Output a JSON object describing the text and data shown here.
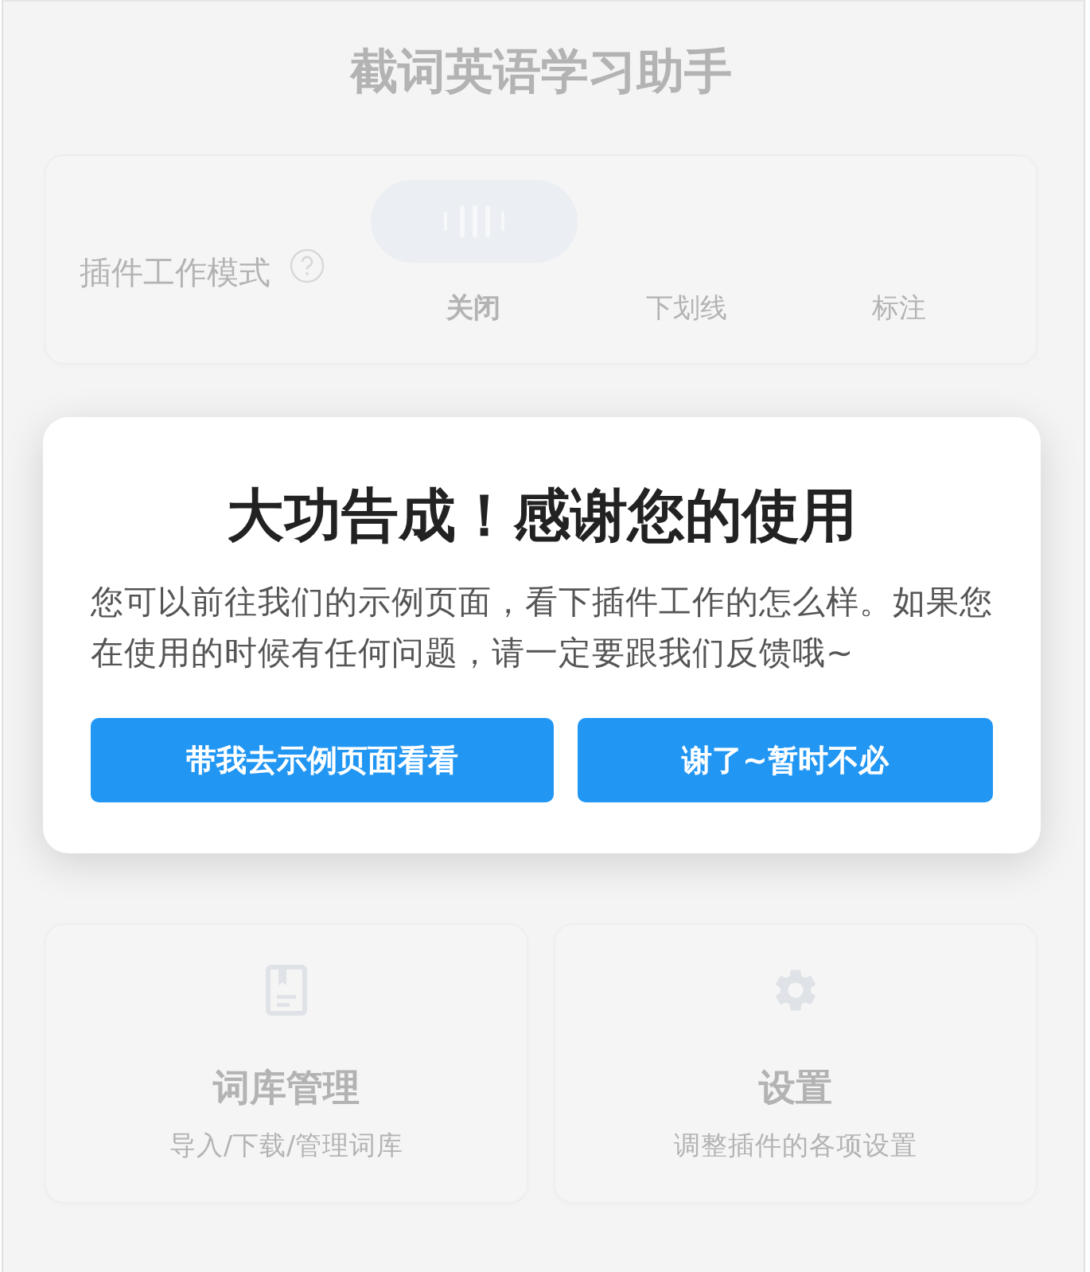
{
  "app_title": "截词英语学习助手",
  "mode_setting": {
    "label": "插件工作模式",
    "options": [
      {
        "label": "关闭",
        "selected": true
      },
      {
        "label": "下划线",
        "selected": false
      },
      {
        "label": "标注",
        "selected": false
      }
    ]
  },
  "feature_cards": [
    {
      "kind": "book",
      "title": "词库管理",
      "description": "导入/下载/管理词库"
    },
    {
      "kind": "settings",
      "title": "设置",
      "description": "调整插件的各项设置"
    }
  ],
  "dialog": {
    "title": "大功告成！感谢您的使用",
    "message": "您可以前往我们的示例页面，看下插件工作的怎么样。如果您在使用的时候有任何问题，请一定要跟我们反馈哦~",
    "buttons": [
      "带我去示例页面看看",
      "谢了~暂时不必"
    ]
  }
}
